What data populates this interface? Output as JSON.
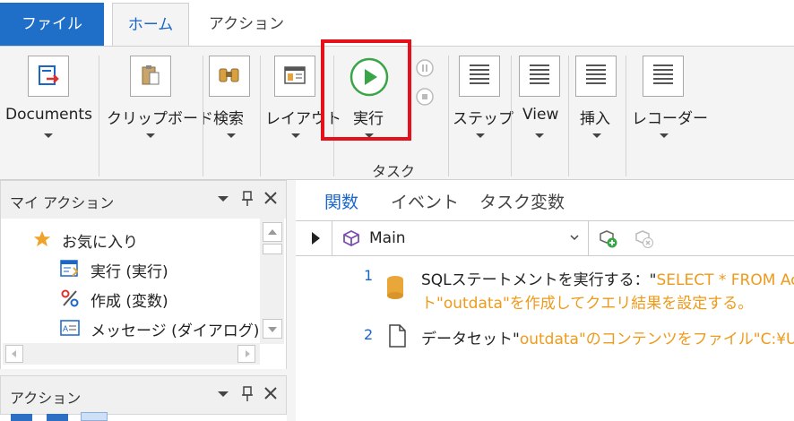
{
  "tabs": {
    "file": "ファイル",
    "home": "ホーム",
    "action": "アクション"
  },
  "ribbon": {
    "documents": "Documents",
    "clipboard": "クリップボード",
    "search": "検索",
    "layout": "レイアウト",
    "run": "実行",
    "step": "ステップ",
    "view": "View",
    "insert": "挿入",
    "recorder": "レコーダー",
    "group_task": "タスク"
  },
  "my_actions": {
    "title": "マイ アクション",
    "items": [
      {
        "label": "お気に入り",
        "icon": "star-icon"
      },
      {
        "label": "実行 (実行)",
        "icon": "run-form-icon"
      },
      {
        "label": "作成 (変数)",
        "icon": "percent-icon"
      },
      {
        "label": "メッセージ (ダイアログ)",
        "icon": "message-dialog-icon"
      }
    ]
  },
  "actions_panel": {
    "title": "アクション"
  },
  "main": {
    "tabs": [
      "関数",
      "イベント",
      "タスク変数"
    ],
    "function_name": "Main",
    "steps": [
      {
        "num": "1",
        "prefix": "SQLステートメントを実行する：\"",
        "value": "SELECT * FROM Acco",
        "line2": "ト\"outdata\"を作成してクエリ結果を設定する。",
        "icon": "database-icon"
      },
      {
        "num": "2",
        "prefix": "データセット\"",
        "value": "outdata\"のコンテンツをファイル\"C:¥Users",
        "icon": "document-icon"
      }
    ]
  },
  "colors": {
    "accent": "#1f6fc8",
    "highlight": "#e5111a",
    "orange": "#ee9a1a",
    "run_green": "#3aa546"
  }
}
